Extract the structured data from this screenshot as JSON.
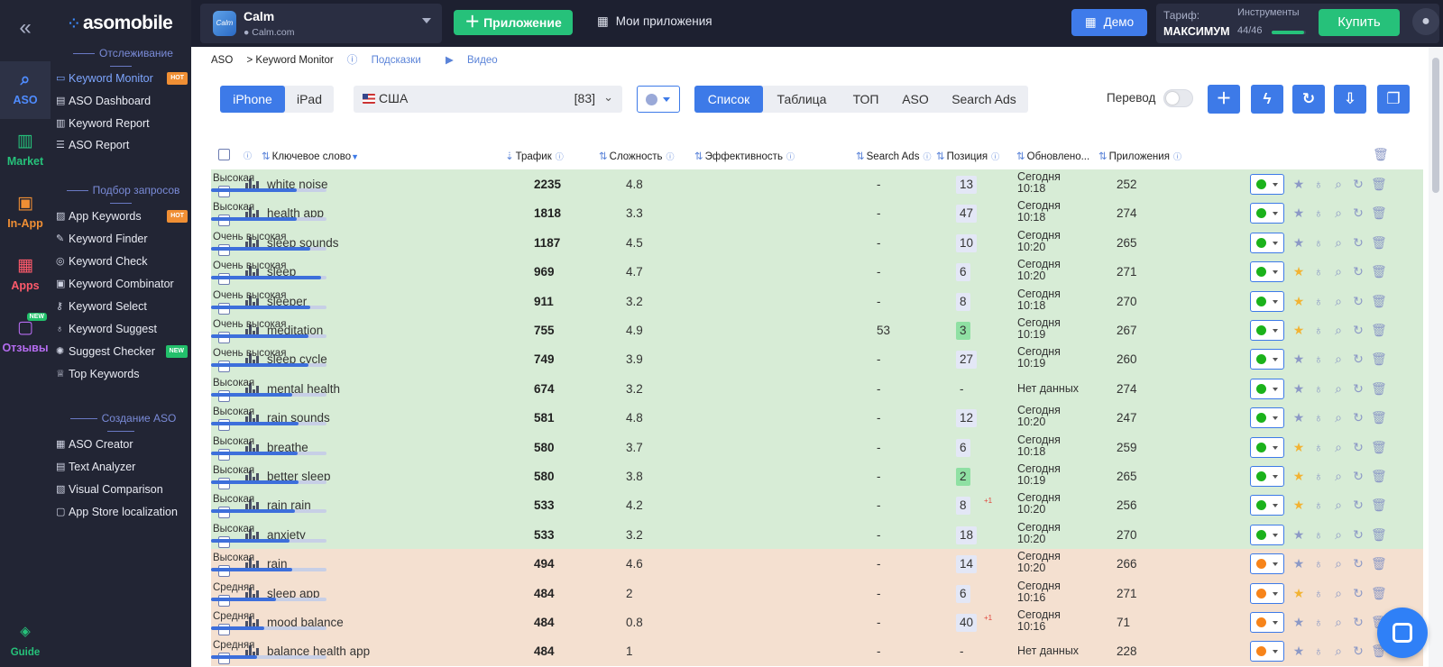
{
  "nav_rail": {
    "items": [
      {
        "label": "ASO",
        "icon": "search-icon",
        "color": "#4f8cff"
      },
      {
        "label": "Market",
        "icon": "bar-chart-icon",
        "color": "#26c17a"
      },
      {
        "label": "In-App",
        "icon": "cart-icon",
        "color": "#f08f34"
      },
      {
        "label": "Apps",
        "icon": "grid-icon",
        "color": "#ff5a6b"
      },
      {
        "label": "Отзывы",
        "icon": "chat-bubble-icon",
        "color": "#b56cf0",
        "badge": "NEW"
      }
    ],
    "guide_label": "Guide"
  },
  "sidebar": {
    "logo": "asomobile",
    "sections": {
      "tracking": "Отслеживание",
      "keyword_selection": "Подбор запросов",
      "aso_creation": "Создание ASO"
    },
    "tracking_items": [
      {
        "label": "Keyword Monitor",
        "badge": "HOT"
      },
      {
        "label": "ASO Dashboard"
      },
      {
        "label": "Keyword Report"
      },
      {
        "label": "ASO Report"
      }
    ],
    "selection_items": [
      {
        "label": "App Keywords",
        "badge": "HOT"
      },
      {
        "label": "Keyword Finder"
      },
      {
        "label": "Keyword Check"
      },
      {
        "label": "Keyword Combinator"
      },
      {
        "label": "Keyword Select"
      },
      {
        "label": "Keyword Suggest"
      },
      {
        "label": "Suggest Checker",
        "badge": "NEW"
      },
      {
        "label": "Top Keywords"
      }
    ],
    "creation_items": [
      {
        "label": "ASO Creator"
      },
      {
        "label": "Text Analyzer"
      },
      {
        "label": "Visual Comparison"
      },
      {
        "label": "App Store localization"
      }
    ]
  },
  "topbar": {
    "app_icon_text": "Calm",
    "app_name": "Calm",
    "app_domain": "Calm.com",
    "add_app": "Приложение",
    "my_apps": "Мои приложения",
    "demo": "Демо",
    "tariff_label": "Тариф:",
    "tariff_value": "МАКСИМУМ",
    "tools_label": "Инструменты",
    "tools_count": "44/46",
    "tools_used_fraction": 0.96,
    "buy": "Купить"
  },
  "breadcrumb": {
    "root": "ASO",
    "current": "> Keyword Monitor",
    "hints": "Подсказки",
    "video": "Видео"
  },
  "filters": {
    "devices": [
      "iPhone",
      "iPad"
    ],
    "device_selected": "iPhone",
    "country": "США",
    "country_count": "[83]",
    "views": [
      "Список",
      "Таблица",
      "ТОП",
      "ASO",
      "Search Ads"
    ],
    "view_selected": "Список",
    "translate_label": "Перевод"
  },
  "table": {
    "headers": {
      "keyword": "Ключевое слово",
      "traffic": "Трафик",
      "complexity": "Сложность",
      "efficiency": "Эффективность",
      "search_ads": "Search Ads",
      "position": "Позиция",
      "updated": "Обновлено...",
      "apps": "Приложения"
    },
    "rows": [
      {
        "keyword": "white noise",
        "traffic": "2235",
        "complexity": "4.8",
        "efficiency": "Высокая",
        "eff_level": 0.74,
        "search_ads": "-",
        "position": "13",
        "pos_style": "bg",
        "updated": "Сегодня 10:18",
        "apps": "252",
        "color": "green",
        "starred": false
      },
      {
        "keyword": "health app",
        "traffic": "1818",
        "complexity": "3.3",
        "efficiency": "Высокая",
        "eff_level": 0.74,
        "search_ads": "-",
        "position": "47",
        "pos_style": "bg",
        "updated": "Сегодня 10:18",
        "apps": "274",
        "color": "green",
        "starred": false
      },
      {
        "keyword": "sleep sounds",
        "traffic": "1187",
        "complexity": "4.5",
        "efficiency": "Очень высокая",
        "eff_level": 0.86,
        "search_ads": "-",
        "position": "10",
        "pos_style": "bg",
        "updated": "Сегодня 10:20",
        "apps": "265",
        "color": "green",
        "starred": false
      },
      {
        "keyword": "sleep",
        "traffic": "969",
        "complexity": "4.7",
        "efficiency": "Очень высокая",
        "eff_level": 0.95,
        "search_ads": "-",
        "position": "6",
        "pos_style": "bg",
        "updated": "Сегодня 10:20",
        "apps": "271",
        "color": "green",
        "starred": true
      },
      {
        "keyword": "sleeper",
        "traffic": "911",
        "complexity": "3.2",
        "efficiency": "Очень высокая",
        "eff_level": 0.86,
        "search_ads": "-",
        "position": "8",
        "pos_style": "bg",
        "updated": "Сегодня 10:18",
        "apps": "270",
        "color": "green",
        "starred": true
      },
      {
        "keyword": "meditation",
        "traffic": "755",
        "complexity": "4.9",
        "efficiency": "Очень высокая",
        "eff_level": 0.84,
        "search_ads": "53",
        "position": "3",
        "pos_style": "top",
        "updated": "Сегодня 10:19",
        "apps": "267",
        "color": "green",
        "starred": true
      },
      {
        "keyword": "sleep cycle",
        "traffic": "749",
        "complexity": "3.9",
        "efficiency": "Очень высокая",
        "eff_level": 0.84,
        "search_ads": "-",
        "position": "27",
        "pos_style": "bg",
        "updated": "Сегодня 10:19",
        "apps": "260",
        "color": "green",
        "starred": false
      },
      {
        "keyword": "mental health",
        "traffic": "674",
        "complexity": "3.2",
        "efficiency": "Высокая",
        "eff_level": 0.7,
        "search_ads": "-",
        "position": "-",
        "pos_style": "none",
        "updated": "Нет данных",
        "apps": "274",
        "color": "green",
        "starred": false
      },
      {
        "keyword": "rain sounds",
        "traffic": "581",
        "complexity": "4.8",
        "efficiency": "Высокая",
        "eff_level": 0.76,
        "search_ads": "-",
        "position": "12",
        "pos_style": "bg",
        "updated": "Сегодня 10:20",
        "apps": "247",
        "color": "green",
        "starred": false
      },
      {
        "keyword": "breathe",
        "traffic": "580",
        "complexity": "3.7",
        "efficiency": "Высокая",
        "eff_level": 0.75,
        "search_ads": "-",
        "position": "6",
        "pos_style": "bg",
        "updated": "Сегодня 10:18",
        "apps": "259",
        "color": "green",
        "starred": true
      },
      {
        "keyword": "better sleep",
        "traffic": "580",
        "complexity": "3.8",
        "efficiency": "Высокая",
        "eff_level": 0.76,
        "search_ads": "-",
        "position": "2",
        "pos_style": "top",
        "updated": "Сегодня 10:19",
        "apps": "265",
        "color": "green",
        "starred": true
      },
      {
        "keyword": "rain rain",
        "traffic": "533",
        "complexity": "4.2",
        "efficiency": "Высокая",
        "eff_level": 0.73,
        "search_ads": "-",
        "position": "8",
        "pos_style": "bg",
        "delta": "+1",
        "updated": "Сегодня 10:20",
        "apps": "256",
        "color": "green",
        "starred": true
      },
      {
        "keyword": "anxiety",
        "traffic": "533",
        "complexity": "3.2",
        "efficiency": "Высокая",
        "eff_level": 0.68,
        "search_ads": "-",
        "position": "18",
        "pos_style": "bg",
        "updated": "Сегодня 10:20",
        "apps": "270",
        "color": "green",
        "starred": false
      },
      {
        "keyword": "rain",
        "traffic": "494",
        "complexity": "4.6",
        "efficiency": "Высокая",
        "eff_level": 0.7,
        "search_ads": "-",
        "position": "14",
        "pos_style": "bg",
        "updated": "Сегодня 10:20",
        "apps": "266",
        "color": "orange",
        "starred": false
      },
      {
        "keyword": "sleep app",
        "traffic": "484",
        "complexity": "2",
        "efficiency": "Средняя",
        "eff_level": 0.56,
        "search_ads": "-",
        "position": "6",
        "pos_style": "bg",
        "updated": "Сегодня 10:16",
        "apps": "271",
        "color": "orange",
        "starred": true
      },
      {
        "keyword": "mood balance",
        "traffic": "484",
        "complexity": "0.8",
        "efficiency": "Средняя",
        "eff_level": 0.46,
        "search_ads": "-",
        "position": "40",
        "pos_style": "bg",
        "delta": "+1",
        "updated": "Сегодня 10:16",
        "apps": "71",
        "color": "orange",
        "starred": false
      },
      {
        "keyword": "balance health app",
        "traffic": "484",
        "complexity": "1",
        "efficiency": "Средняя",
        "eff_level": 0.4,
        "search_ads": "-",
        "position": "-",
        "pos_style": "none",
        "updated": "Нет данных",
        "apps": "228",
        "color": "orange",
        "starred": false
      }
    ]
  },
  "colors": {
    "row_green": "#d7ecd6",
    "row_orange": "#f4e0d0",
    "dot_green": "#1bb21b",
    "dot_orange": "#f7841a",
    "accent": "#3d7ae8"
  }
}
